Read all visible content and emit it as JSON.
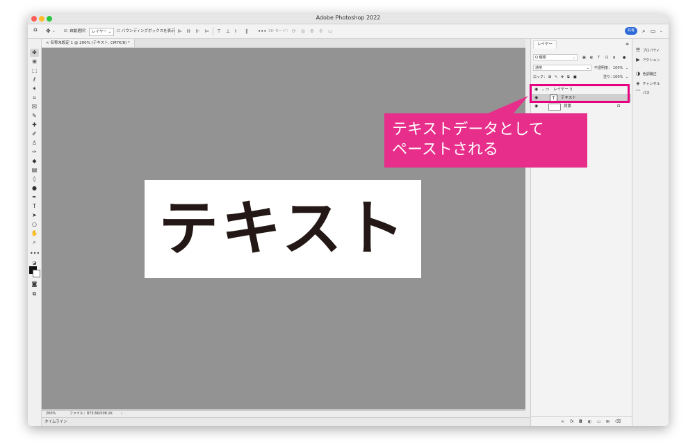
{
  "window": {
    "title": "Adobe Photoshop 2022"
  },
  "options_bar": {
    "auto_select_label": "自動選択：",
    "auto_select_value": "レイヤー",
    "bounding_box_label": "バウンディングボックスを表示",
    "mode_3d_label": "3D モード：",
    "share_label": "共有"
  },
  "document": {
    "tab_title": "名称未設定 1 @ 200% (テキスト, CMYK/8) *",
    "canvas_text": "テキスト",
    "zoom": "200%",
    "file_info": "ファイル：873.6K/508.1K"
  },
  "timeline": {
    "label": "タイムライン"
  },
  "layers_panel": {
    "tab_label": "レイヤー",
    "filter_kind": "Q 種類",
    "blend_mode": "通常",
    "opacity_label": "不透明度：",
    "opacity_value": "100%",
    "lock_label": "ロック：",
    "fill_label": "塗り：",
    "fill_value": "100%",
    "layers": [
      {
        "name": "レイヤー 3",
        "type": "group"
      },
      {
        "name": "テキスト",
        "type": "text"
      },
      {
        "name": "背景",
        "type": "background"
      }
    ]
  },
  "right_panel": {
    "items": [
      {
        "label": "プロパティ",
        "icon": "properties-icon"
      },
      {
        "label": "アクション",
        "icon": "actions-icon"
      },
      {
        "label": "色調補正",
        "icon": "adjustments-icon"
      },
      {
        "label": "チャンネル",
        "icon": "channels-icon"
      },
      {
        "label": "パス",
        "icon": "paths-icon"
      }
    ]
  },
  "annotation": {
    "line1": "テキストデータとして",
    "line2": "ペーストされる",
    "color": "#e72e8b"
  }
}
